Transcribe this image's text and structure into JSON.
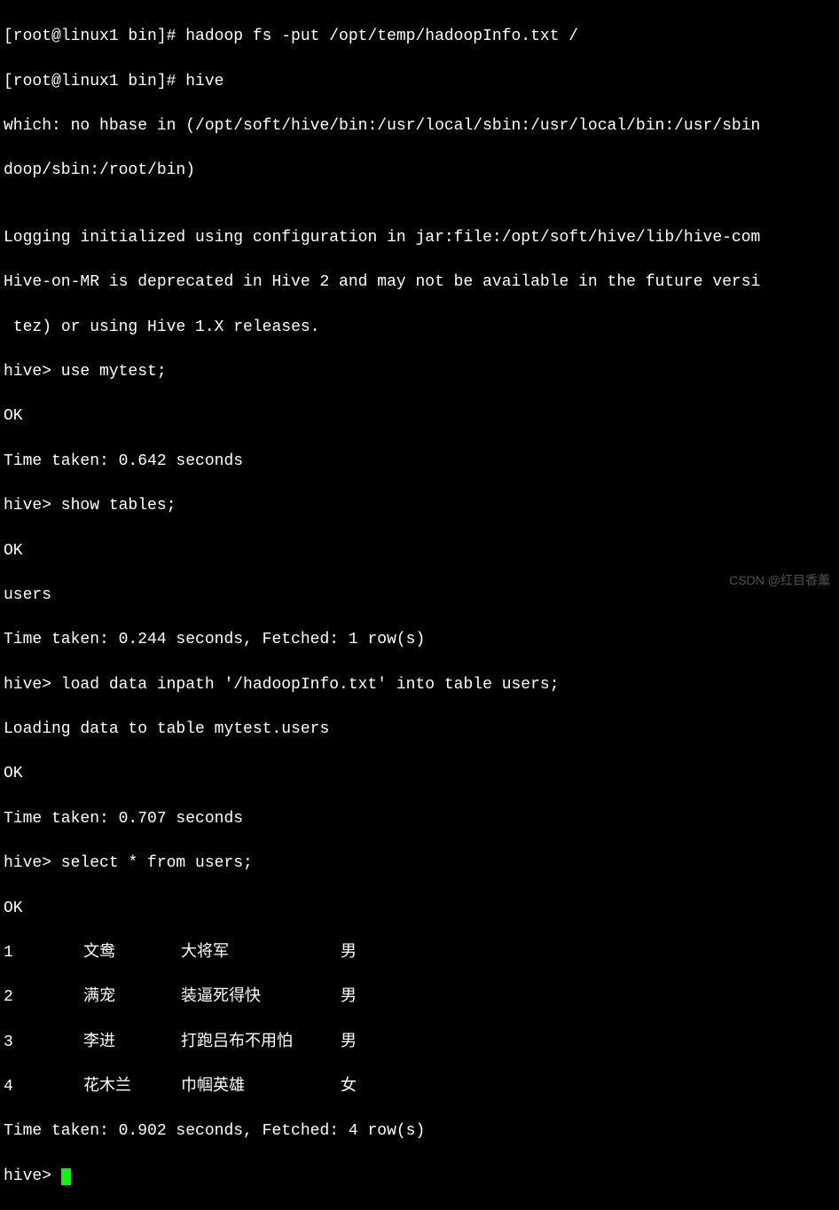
{
  "lines": {
    "l0": "[root@linux1 bin]# hadoop fs -put /opt/temp/hadoopInfo.txt /",
    "l1": "[root@linux1 bin]# hive",
    "l2": "which: no hbase in (/opt/soft/hive/bin:/usr/local/sbin:/usr/local/bin:/usr/sbin",
    "l3": "doop/sbin:/root/bin)",
    "l4": "",
    "l5": "Logging initialized using configuration in jar:file:/opt/soft/hive/lib/hive-com",
    "l6": "Hive-on-MR is deprecated in Hive 2 and may not be available in the future versi",
    "l7": " tez) or using Hive 1.X releases.",
    "l8": "hive> use mytest;",
    "l9": "OK",
    "l10": "Time taken: 0.642 seconds",
    "l11": "hive> show tables;",
    "l12": "OK",
    "l13": "users",
    "l14": "Time taken: 0.244 seconds, Fetched: 1 row(s)",
    "l15": "hive> load data inpath '/hadoopInfo.txt' into table users;",
    "l16": "Loading data to table mytest.users",
    "l17": "OK",
    "l18": "Time taken: 0.707 seconds",
    "l19": "hive> select * from users;",
    "l20": "OK",
    "l25": "Time taken: 0.902 seconds, Fetched: 4 row(s)",
    "l26": "hive> "
  },
  "rows": [
    {
      "id": "1",
      "name": "文鸯",
      "title": "大将军",
      "gender": "男"
    },
    {
      "id": "2",
      "name": "满宠",
      "title": "装逼死得快",
      "gender": "男"
    },
    {
      "id": "3",
      "name": "李进",
      "title": "打跑吕布不用怕",
      "gender": "男"
    },
    {
      "id": "4",
      "name": "花木兰",
      "title": "巾帼英雄",
      "gender": "女"
    }
  ],
  "watermark": "CSDN @红目香薰"
}
